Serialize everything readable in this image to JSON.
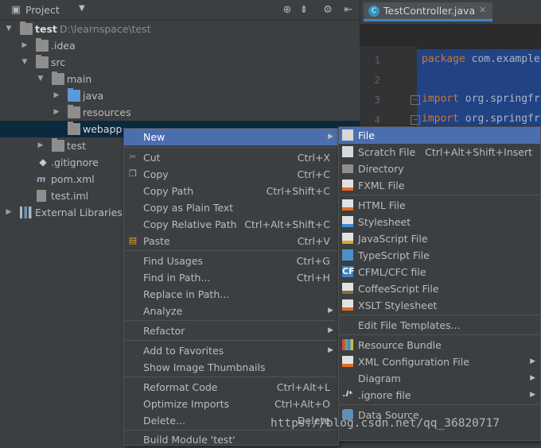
{
  "project_header": {
    "title": "Project",
    "icons": [
      "project-view-icon",
      "locate-icon",
      "collapse-all-icon",
      "gear-icon",
      "hide-icon"
    ]
  },
  "tree": [
    {
      "label": "test",
      "path": "D:\\learnspace\\test",
      "expanded": true
    },
    {
      "label": ".idea"
    },
    {
      "label": "src",
      "expanded": true
    },
    {
      "label": "main",
      "expanded": true
    },
    {
      "label": "java"
    },
    {
      "label": "resources"
    },
    {
      "label": "webapp",
      "selected": true
    },
    {
      "label": "test"
    },
    {
      "label": ".gitignore"
    },
    {
      "label": "pom.xml"
    },
    {
      "label": "test.iml"
    },
    {
      "label": "External Libraries"
    }
  ],
  "editor": {
    "tab_label": "TestController.java",
    "tab_icon": "C",
    "line_numbers": [
      "1",
      "2",
      "3",
      "4"
    ],
    "lines": [
      {
        "keyword": "package",
        "rest": " com.example"
      },
      {
        "keyword": "",
        "rest": ""
      },
      {
        "keyword": "import",
        "rest": " org.springfr"
      },
      {
        "keyword": "import",
        "rest": " org.springfr"
      }
    ]
  },
  "context_menu": {
    "items": [
      {
        "label": "New",
        "has_submenu": true,
        "highlighted": true
      },
      {
        "label": "Cut",
        "shortcut": "Ctrl+X",
        "icon": "scissors-icon"
      },
      {
        "label": "Copy",
        "shortcut": "Ctrl+C",
        "icon": "copy-icon"
      },
      {
        "label": "Copy Path",
        "shortcut": "Ctrl+Shift+C"
      },
      {
        "label": "Copy as Plain Text",
        "shortcut": ""
      },
      {
        "label": "Copy Relative Path",
        "shortcut": "Ctrl+Alt+Shift+C"
      },
      {
        "label": "Paste",
        "shortcut": "Ctrl+V",
        "icon": "paste-icon"
      },
      {
        "label": "Find Usages",
        "shortcut": "Ctrl+G"
      },
      {
        "label": "Find in Path...",
        "shortcut": "Ctrl+H"
      },
      {
        "label": "Replace in Path...",
        "shortcut": ""
      },
      {
        "label": "Analyze",
        "has_submenu": true
      },
      {
        "label": "Refactor",
        "has_submenu": true
      },
      {
        "label": "Add to Favorites",
        "has_submenu": true
      },
      {
        "label": "Show Image Thumbnails",
        "shortcut": ""
      },
      {
        "label": "Reformat Code",
        "shortcut": "Ctrl+Alt+L"
      },
      {
        "label": "Optimize Imports",
        "shortcut": "Ctrl+Alt+O"
      },
      {
        "label": "Delete...",
        "shortcut": "Delete"
      },
      {
        "label": "Build Module 'test'",
        "shortcut": ""
      }
    ]
  },
  "submenu": {
    "items": [
      {
        "label": "File",
        "highlighted": true,
        "icon": "file-icon"
      },
      {
        "label": "Scratch File",
        "shortcut": "Ctrl+Alt+Shift+Insert",
        "icon": "scratch-file-icon"
      },
      {
        "label": "Directory",
        "icon": "folder-icon"
      },
      {
        "label": "FXML File",
        "icon": "fxml-file-icon"
      },
      {
        "label": "HTML File",
        "icon": "html-file-icon"
      },
      {
        "label": "Stylesheet",
        "icon": "css-file-icon"
      },
      {
        "label": "JavaScript File",
        "icon": "js-file-icon"
      },
      {
        "label": "TypeScript File",
        "icon": "ts-file-icon"
      },
      {
        "label": "CFML/CFC file",
        "icon": "cf-file-icon"
      },
      {
        "label": "CoffeeScript File",
        "icon": "coffee-file-icon"
      },
      {
        "label": "XSLT Stylesheet",
        "icon": "xslt-file-icon"
      },
      {
        "label": "Edit File Templates...",
        "icon": ""
      },
      {
        "label": "Resource Bundle",
        "icon": "resource-bundle-icon"
      },
      {
        "label": "XML Configuration File",
        "has_submenu": true,
        "icon": "xml-file-icon"
      },
      {
        "label": "Diagram",
        "has_submenu": true,
        "icon": ""
      },
      {
        "label": ".ignore file",
        "has_submenu": true,
        "icon": "ignore-file-icon",
        "icon_text": ".i*"
      },
      {
        "label": "Data Source",
        "icon": "database-icon"
      }
    ]
  },
  "watermark": "https://blog.csdn.net/qq_36820717"
}
